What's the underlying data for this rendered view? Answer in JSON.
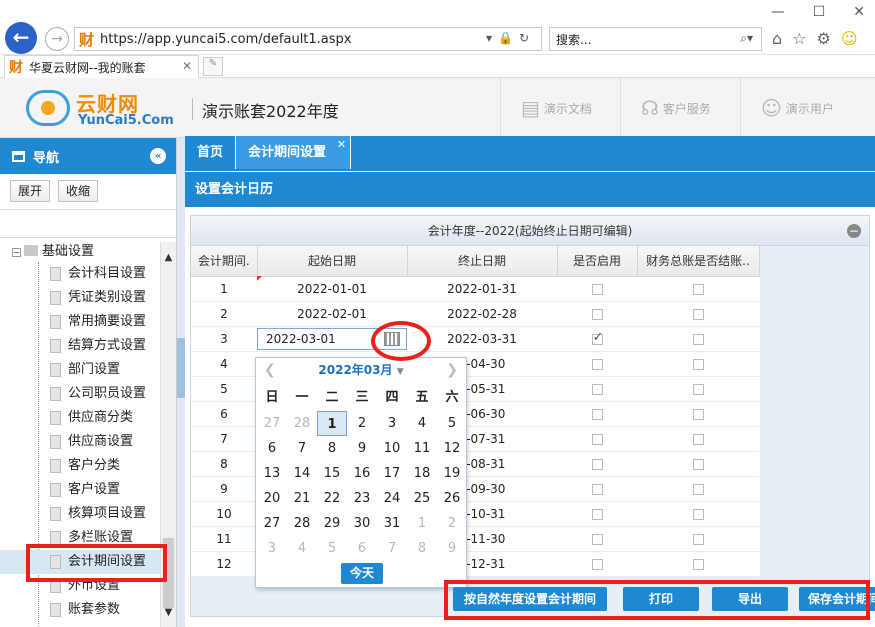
{
  "browser": {
    "url": "https://app.yuncai5.com/default1.aspx",
    "url_favicon": "财",
    "search_placeholder": "搜索...",
    "tab_title": "华夏云财网--我的账套"
  },
  "header": {
    "logo_cn": "云财网",
    "logo_en": "YunCai5.Com",
    "account_title": "演示账套2022年度",
    "nav": [
      {
        "label": "演示文档",
        "icon": "document-icon"
      },
      {
        "label": "客户服务",
        "icon": "headset-icon"
      },
      {
        "label": "演示用户",
        "icon": "user-icon"
      }
    ]
  },
  "sidebar": {
    "title": "导航",
    "expand_label": "展开",
    "collapse_label": "收缩",
    "root_label": "基础设置",
    "items": [
      "会计科目设置",
      "凭证类别设置",
      "常用摘要设置",
      "结算方式设置",
      "部门设置",
      "公司职员设置",
      "供应商分类",
      "供应商设置",
      "客户分类",
      "客户设置",
      "核算项目设置",
      "多栏账设置",
      "会计期间设置",
      "外币设置",
      "账套参数"
    ],
    "selected_index": 12
  },
  "main": {
    "tabs": [
      {
        "label": "首页",
        "active": false
      },
      {
        "label": "会计期间设置",
        "active": true
      }
    ],
    "panel_title": "设置会计日历",
    "grid_title": "会计年度--2022(起始终止日期可编辑)",
    "columns": [
      "会计期间.",
      "起始日期",
      "终止日期",
      "是否启用",
      "财务总账是否结账.."
    ],
    "rows": [
      {
        "period": "1",
        "start": "2022-01-01",
        "end": "2022-01-31",
        "enabled": false,
        "closed": false
      },
      {
        "period": "2",
        "start": "2022-02-01",
        "end": "2022-02-28",
        "enabled": false,
        "closed": false
      },
      {
        "period": "3",
        "start": "2022-03-01",
        "end": "2022-03-31",
        "enabled": true,
        "closed": false
      },
      {
        "period": "4",
        "start": "",
        "end": "2-04-30",
        "enabled": false,
        "closed": false
      },
      {
        "period": "5",
        "start": "",
        "end": "2-05-31",
        "enabled": false,
        "closed": false
      },
      {
        "period": "6",
        "start": "",
        "end": "2-06-30",
        "enabled": false,
        "closed": false
      },
      {
        "period": "7",
        "start": "",
        "end": "2-07-31",
        "enabled": false,
        "closed": false
      },
      {
        "period": "8",
        "start": "",
        "end": "2-08-31",
        "enabled": false,
        "closed": false
      },
      {
        "period": "9",
        "start": "",
        "end": "2-09-30",
        "enabled": false,
        "closed": false
      },
      {
        "period": "10",
        "start": "",
        "end": "2-10-31",
        "enabled": false,
        "closed": false
      },
      {
        "period": "11",
        "start": "",
        "end": "2-11-30",
        "enabled": false,
        "closed": false
      },
      {
        "period": "12",
        "start": "",
        "end": "2-12-31",
        "enabled": false,
        "closed": false
      }
    ],
    "editing_value": "2022-03-01"
  },
  "datepicker": {
    "month_label": "2022年03月",
    "weekdays": [
      "日",
      "一",
      "二",
      "三",
      "四",
      "五",
      "六"
    ],
    "days": [
      [
        "27",
        true
      ],
      [
        "28",
        true
      ],
      [
        "1",
        false
      ],
      [
        "2",
        false
      ],
      [
        "3",
        false
      ],
      [
        "4",
        false
      ],
      [
        "5",
        false
      ],
      [
        "6",
        false
      ],
      [
        "7",
        false
      ],
      [
        "8",
        false
      ],
      [
        "9",
        false
      ],
      [
        "10",
        false
      ],
      [
        "11",
        false
      ],
      [
        "12",
        false
      ],
      [
        "13",
        false
      ],
      [
        "14",
        false
      ],
      [
        "15",
        false
      ],
      [
        "16",
        false
      ],
      [
        "17",
        false
      ],
      [
        "18",
        false
      ],
      [
        "19",
        false
      ],
      [
        "20",
        false
      ],
      [
        "21",
        false
      ],
      [
        "22",
        false
      ],
      [
        "23",
        false
      ],
      [
        "24",
        false
      ],
      [
        "25",
        false
      ],
      [
        "26",
        false
      ],
      [
        "27",
        false
      ],
      [
        "28",
        false
      ],
      [
        "29",
        false
      ],
      [
        "30",
        false
      ],
      [
        "31",
        false
      ],
      [
        "1",
        true
      ],
      [
        "2",
        true
      ],
      [
        "3",
        true
      ],
      [
        "4",
        true
      ],
      [
        "5",
        true
      ],
      [
        "6",
        true
      ],
      [
        "7",
        true
      ],
      [
        "8",
        true
      ],
      [
        "9",
        true
      ]
    ],
    "selected_day_index": 2,
    "today_label": "今天"
  },
  "actions": {
    "natural_year": "按自然年度设置会计期间",
    "print": "打印",
    "export": "导出",
    "save": "保存会计期间"
  },
  "colors": {
    "primary": "#1e88d2",
    "annotation_red": "#e8221b",
    "logo_orange": "#f08a00"
  }
}
